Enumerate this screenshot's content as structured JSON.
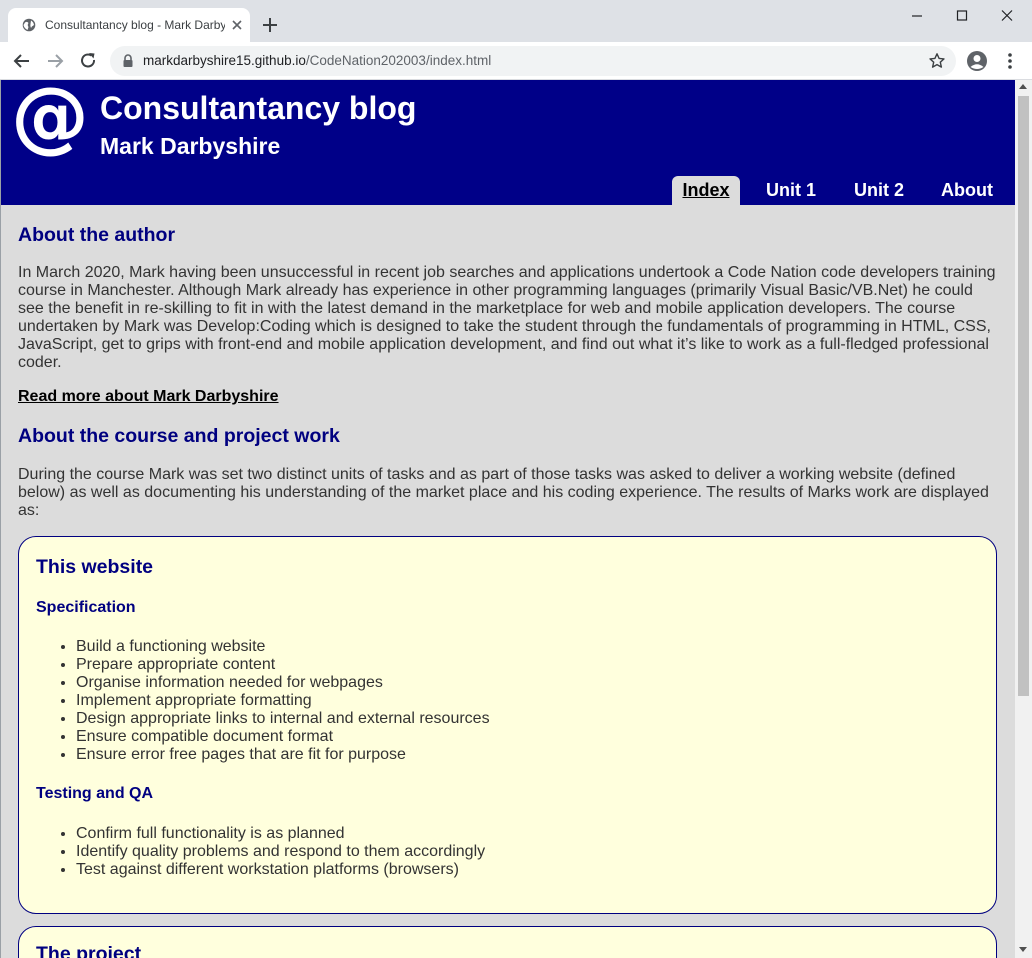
{
  "browser": {
    "tab_title": "Consultantancy blog - Mark Darbyshire",
    "url_domain": "markdarbyshire15.github.io",
    "url_path": "/CodeNation202003/index.html"
  },
  "header": {
    "logo": "@",
    "title": "Consultantancy blog",
    "author": "Mark Darbyshire"
  },
  "nav": {
    "items": [
      {
        "label": "Index",
        "active": true
      },
      {
        "label": "Unit 1",
        "active": false
      },
      {
        "label": "Unit 2",
        "active": false
      },
      {
        "label": "About",
        "active": false
      }
    ]
  },
  "main": {
    "about_author_heading": "About the author",
    "about_author_text": "In March 2020, Mark having been unsuccessful in recent job searches and applications undertook a Code Nation code developers training course in Manchester. Although Mark already has experience in other programming languages (primarily Visual Basic/VB.Net) he could see the benefit in re-skilling to fit in with the latest demand in the marketplace for web and mobile application developers. The course undertaken by Mark was Develop:Coding which is designed to take the student through the fundamentals of programming in HTML, CSS, JavaScript, get to grips with front-end and mobile application development, and find out what it’s like to work as a full-fledged professional coder.",
    "read_more_link": "Read more about Mark Darbyshire",
    "course_heading": "About the course and project work",
    "course_text": "During the course Mark was set two distinct units of tasks and as part of those tasks was asked to deliver a working website (defined below) as well as documenting his understanding of the market place and his coding experience. The results of Marks work are displayed as:",
    "card_website": {
      "heading": "This website",
      "spec_heading": "Specification",
      "spec_items": [
        "Build a functioning website",
        "Prepare appropriate content",
        "Organise information needed for webpages",
        "Implement appropriate formatting",
        "Design appropriate links to internal and external resources",
        "Ensure compatible document format",
        "Ensure error free pages that are fit for purpose"
      ],
      "qa_heading": "Testing and QA",
      "qa_items": [
        "Confirm full functionality is as planned",
        "Identify quality problems and respond to them accordingly",
        "Test against different workstation platforms (browsers)"
      ]
    },
    "card_project": {
      "heading": "The project"
    }
  },
  "colors": {
    "header_bg": "#000088",
    "page_bg": "#dcdcdc",
    "card_bg": "#ffffdd",
    "heading": "#000080"
  }
}
